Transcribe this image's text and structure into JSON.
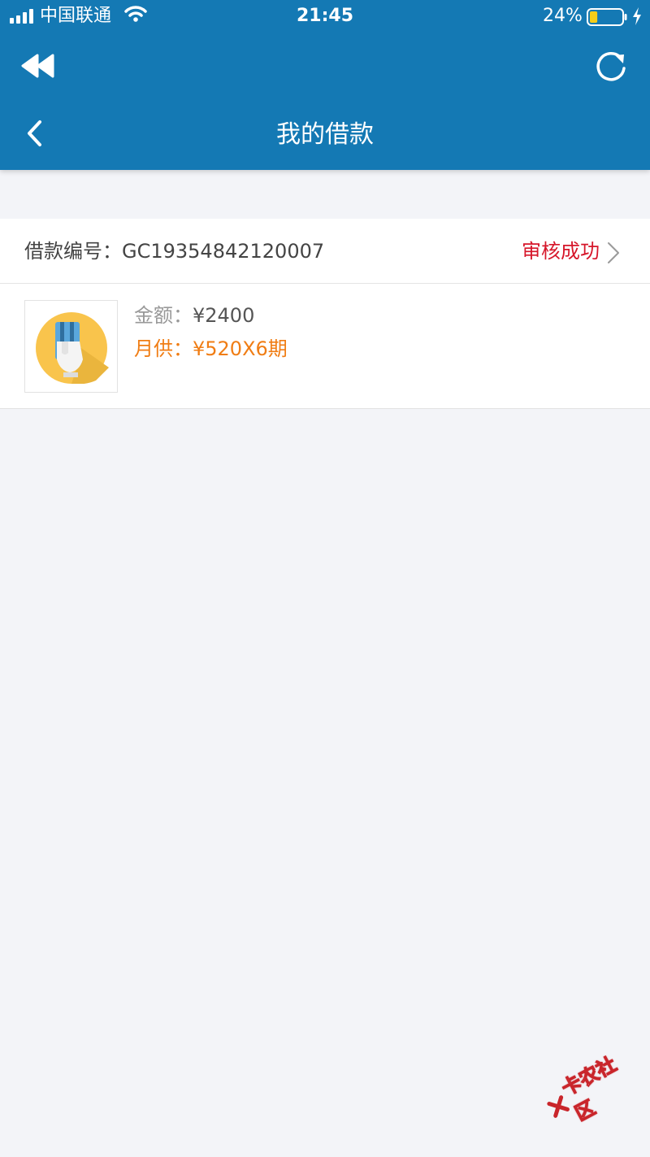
{
  "status_bar": {
    "carrier": "中国联通",
    "time": "21:45",
    "battery_percent": "24%",
    "battery_level": 0.24,
    "icons": [
      "signal-icon",
      "wifi-icon",
      "battery-icon",
      "charging-icon"
    ]
  },
  "toolbar": {
    "rewind_icon": "rewind-icon",
    "refresh_icon": "refresh-icon",
    "back_icon": "back-arrow-icon",
    "title": "我的借款",
    "background_color": "#1479b4"
  },
  "loan": {
    "number_label": "借款编号：",
    "number": "GC19354842120007",
    "status": "审核成功",
    "status_color": "#d6162a",
    "amount_label": "金额：",
    "amount": "¥2400",
    "monthly_label": "月供：",
    "monthly": "¥520X6期",
    "monthly_color": "#f07d14",
    "thumbnail_icon": "card-in-hand-icon"
  },
  "watermark": {
    "text": "卡农社区"
  }
}
